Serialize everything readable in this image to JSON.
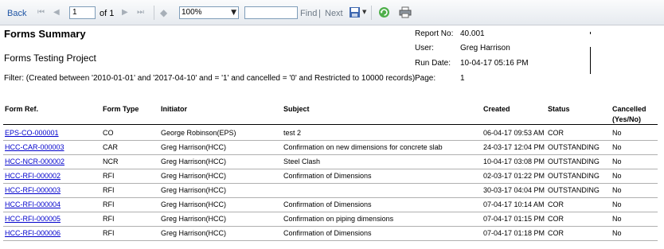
{
  "toolbar": {
    "back_label": "Back",
    "page_value": "1",
    "of_label": "of 1",
    "zoom_value": "100%",
    "find_label": "Find",
    "divider": "|",
    "next_label": "Next"
  },
  "report": {
    "title": "Forms Summary",
    "subtitle": "Forms Testing Project",
    "filter": "Filter: (Created between '2010-01-01' and '2017-04-10' and  = '1' and cancelled = '0' and Restricted to 10000 records)",
    "meta": [
      {
        "label": "Report No:",
        "value": "40.001"
      },
      {
        "label": "User:",
        "value": "Greg Harrison"
      },
      {
        "label": "Run Date:",
        "value": "10-04-17 05:16 PM"
      },
      {
        "label": "Page:",
        "value": "1"
      }
    ]
  },
  "table": {
    "headers": {
      "form_ref": "Form Ref.",
      "form_type": "Form Type",
      "initiator": "Initiator",
      "subject": "Subject",
      "created": "Created",
      "status": "Status",
      "cancelled": "Cancelled",
      "cancelled2": "(Yes/No)"
    },
    "rows": [
      {
        "ref": "EPS-CO-000001",
        "type": "CO",
        "initiator": "George Robinson(EPS)",
        "subject": "test 2",
        "created": "06-04-17 09:53 AM",
        "status": "COR",
        "cancelled": "No"
      },
      {
        "ref": "HCC-CAR-000003",
        "type": "CAR",
        "initiator": "Greg Harrison(HCC)",
        "subject": "Confirmation on new dimensions for concrete slab",
        "created": "24-03-17 12:04 PM",
        "status": "OUTSTANDING",
        "cancelled": "No"
      },
      {
        "ref": "HCC-NCR-000002",
        "type": "NCR",
        "initiator": "Greg Harrison(HCC)",
        "subject": "Steel Clash",
        "created": "10-04-17 03:08 PM",
        "status": "OUTSTANDING",
        "cancelled": "No"
      },
      {
        "ref": "HCC-RFI-000002",
        "type": "RFI",
        "initiator": "Greg Harrison(HCC)",
        "subject": "Confirmation of Dimensions",
        "created": "02-03-17 01:22 PM",
        "status": "OUTSTANDING",
        "cancelled": "No"
      },
      {
        "ref": "HCC-RFI-000003",
        "type": "RFI",
        "initiator": "Greg Harrison(HCC)",
        "subject": "",
        "created": "30-03-17 04:04 PM",
        "status": "OUTSTANDING",
        "cancelled": "No"
      },
      {
        "ref": "HCC-RFI-000004",
        "type": "RFI",
        "initiator": "Greg Harrison(HCC)",
        "subject": "Confirmation of Dimensions",
        "created": "07-04-17 10:14 AM",
        "status": "COR",
        "cancelled": "No"
      },
      {
        "ref": "HCC-RFI-000005",
        "type": "RFI",
        "initiator": "Greg Harrison(HCC)",
        "subject": "Confirmation on piping dimensions",
        "created": "07-04-17 01:15 PM",
        "status": "COR",
        "cancelled": "No"
      },
      {
        "ref": "HCC-RFI-000006",
        "type": "RFI",
        "initiator": "Greg Harrison(HCC)",
        "subject": "Confirmation of Dimensions",
        "created": "07-04-17 01:18 PM",
        "status": "COR",
        "cancelled": "No"
      }
    ]
  }
}
